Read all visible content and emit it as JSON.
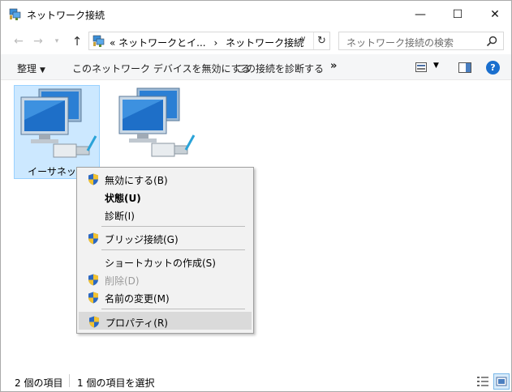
{
  "window": {
    "title": "ネットワーク接続",
    "buttons": {
      "minimize": "—",
      "maximize": "☐",
      "close": "✕"
    }
  },
  "address": {
    "prefix": "«",
    "crumbs": [
      "ネットワークとイ...",
      "ネットワーク接続"
    ],
    "separator": "›",
    "search_placeholder": "ネットワーク接続の検索"
  },
  "commandbar": {
    "organize": "整理",
    "disable": "このネットワーク デバイスを無効にする",
    "diagnose": "この接続を診断する",
    "more": "»"
  },
  "items": [
    {
      "label": "イーサネット",
      "selected": true
    },
    {
      "label": "",
      "selected": false
    }
  ],
  "context_menu": {
    "items": [
      {
        "label": "無効にする(B)",
        "shield": true,
        "bold": false,
        "disabled": false
      },
      {
        "label": "状態(U)",
        "shield": false,
        "bold": true,
        "disabled": false
      },
      {
        "label": "診断(I)",
        "shield": false,
        "bold": false,
        "disabled": false
      },
      {
        "label": "ブリッジ接続(G)",
        "shield": true,
        "bold": false,
        "disabled": false
      },
      {
        "label": "ショートカットの作成(S)",
        "shield": false,
        "bold": false,
        "disabled": false
      },
      {
        "label": "削除(D)",
        "shield": true,
        "bold": false,
        "disabled": true
      },
      {
        "label": "名前の変更(M)",
        "shield": true,
        "bold": false,
        "disabled": false
      },
      {
        "label": "プロパティ(R)",
        "shield": true,
        "bold": false,
        "disabled": false,
        "highlighted": true
      }
    ]
  },
  "status": {
    "count": "2 個の項目",
    "selected": "1 個の項目を選択"
  },
  "colors": {
    "selection": "#cce8ff",
    "menu_bg": "#f2f2f2",
    "menu_hover": "#dadada",
    "help": "#1a6fce"
  }
}
